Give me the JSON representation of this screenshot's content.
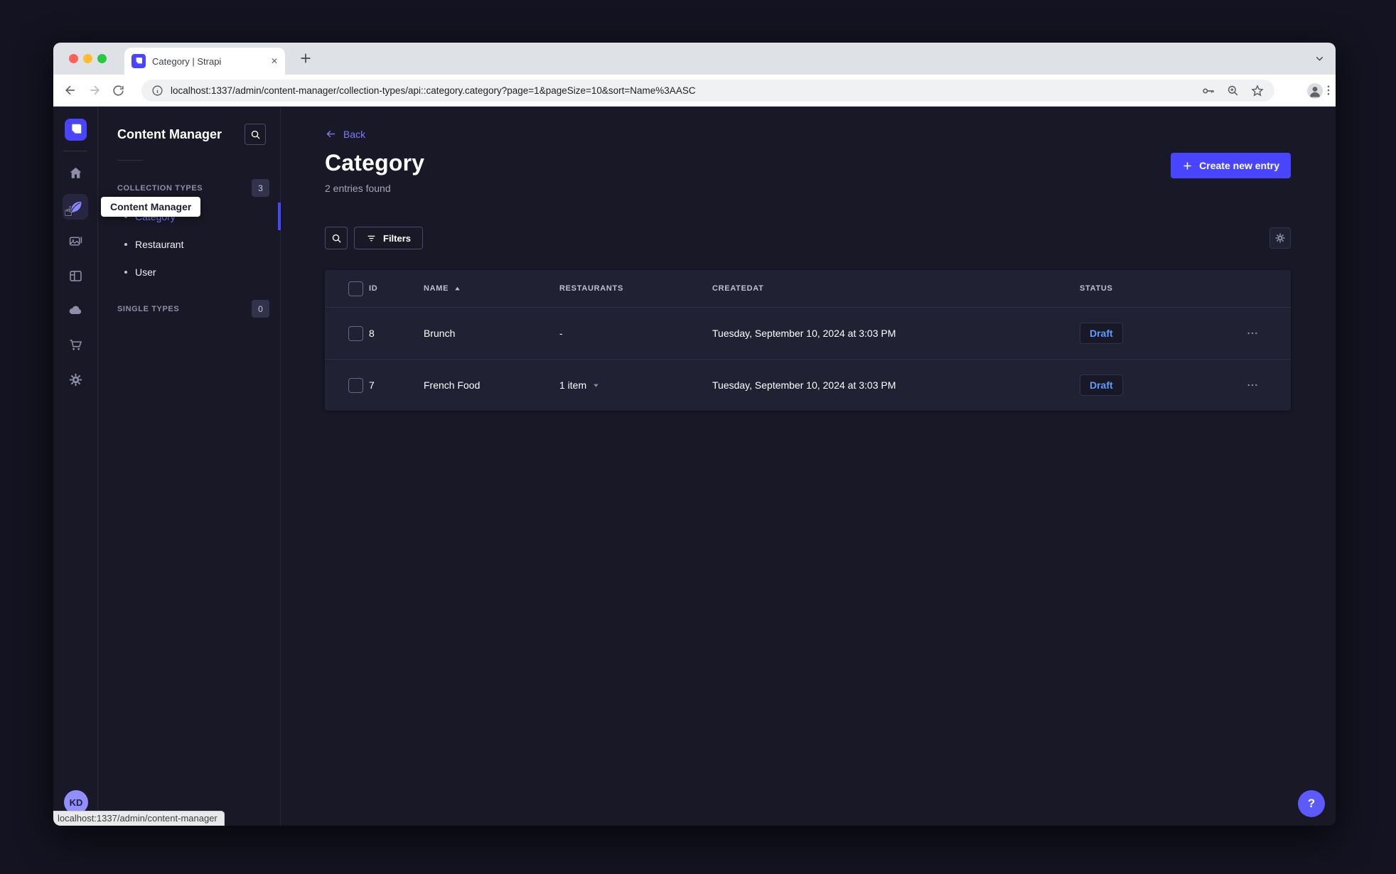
{
  "colors": {
    "primary": "#4945FF",
    "primary-light": "#7B79FF",
    "draft": "#5F9CFF",
    "app-bg": "#181826",
    "panel-bg": "#212134",
    "outer-bg": "#131321"
  },
  "browser": {
    "tab_title": "Category | Strapi",
    "url": "localhost:1337/admin/content-manager/collection-types/api::category.category?page=1&pageSize=10&sort=Name%3AASC",
    "status_bar_url": "localhost:1337/admin/content-manager"
  },
  "nav": {
    "tooltip": "Content Manager",
    "avatar_initials": "KD"
  },
  "subnav": {
    "title": "Content Manager",
    "collection_label": "COLLECTION TYPES",
    "collection_count": "3",
    "single_label": "SINGLE TYPES",
    "single_count": "0",
    "items": [
      {
        "label": "Category",
        "active": true
      },
      {
        "label": "Restaurant",
        "active": false
      },
      {
        "label": "User",
        "active": false
      }
    ]
  },
  "header": {
    "back_label": "Back",
    "title": "Category",
    "subtitle": "2 entries found",
    "create_button_label": "Create new entry"
  },
  "filters": {
    "label": "Filters"
  },
  "table": {
    "headers": {
      "id": "ID",
      "name": "NAME",
      "restaurants": "RESTAURANTS",
      "createdat": "CREATEDAT",
      "status": "STATUS"
    },
    "rows": [
      {
        "id": "8",
        "name": "Brunch",
        "restaurants": "-",
        "has_dropdown": false,
        "createdat": "Tuesday, September 10, 2024 at 3:03 PM",
        "status": "Draft"
      },
      {
        "id": "7",
        "name": "French Food",
        "restaurants": "1 item",
        "has_dropdown": true,
        "createdat": "Tuesday, September 10, 2024 at 3:03 PM",
        "status": "Draft"
      }
    ]
  },
  "help": {
    "icon_label": "?"
  }
}
